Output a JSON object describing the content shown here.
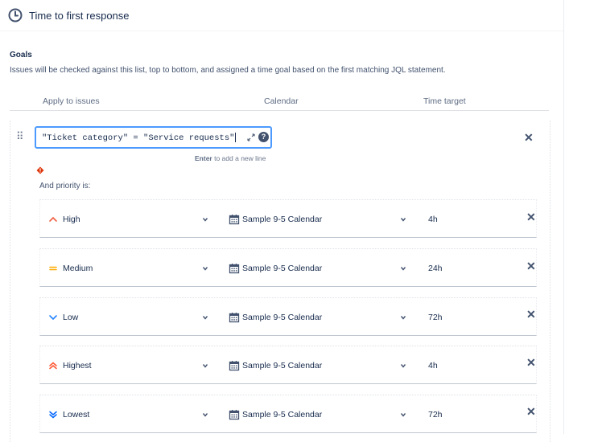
{
  "header": {
    "title": "Time to first response"
  },
  "goals": {
    "title": "Goals",
    "description": "Issues will be checked against this list, top to bottom, and assigned a time goal based on the first matching JQL statement."
  },
  "columns": {
    "apply": "Apply to issues",
    "calendar": "Calendar",
    "time": "Time target"
  },
  "jql": {
    "value": "\"Ticket category\" = \"Service requests\"",
    "hint_key": "Enter",
    "hint_text": "to add a new line"
  },
  "and_priority": "And priority is:",
  "rows": [
    {
      "priority": "High",
      "calendar": "Sample 9-5 Calendar",
      "time": "4h",
      "icon": "priority-high-icon",
      "color": "#f15c3f"
    },
    {
      "priority": "Medium",
      "calendar": "Sample 9-5 Calendar",
      "time": "24h",
      "icon": "priority-medium-icon",
      "color": "#ffab00"
    },
    {
      "priority": "Low",
      "calendar": "Sample 9-5 Calendar",
      "time": "72h",
      "icon": "priority-low-icon",
      "color": "#2684ff"
    },
    {
      "priority": "Highest",
      "calendar": "Sample 9-5 Calendar",
      "time": "4h",
      "icon": "priority-highest-icon",
      "color": "#ff5630"
    },
    {
      "priority": "Lowest",
      "calendar": "Sample 9-5 Calendar",
      "time": "72h",
      "icon": "priority-lowest-icon",
      "color": "#0065ff"
    }
  ],
  "colors": {
    "focus": "#4c9aff",
    "error": "#de350b",
    "text": "#172b4d"
  }
}
